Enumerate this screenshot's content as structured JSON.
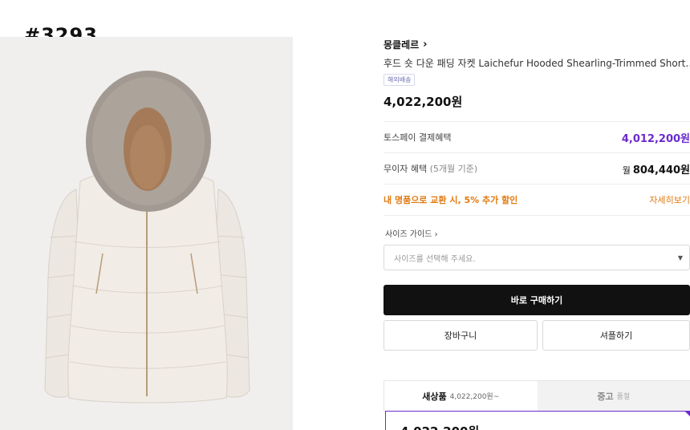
{
  "listing_id": "#3293",
  "product": {
    "brand": "몽클레르",
    "title": "후드 숏 다운 패딩 자켓 Laichefur Hooded Shearling-Trimmed Short Down Jacket",
    "shipping_badge": "해외배송",
    "price": "4,022,200원"
  },
  "benefits": [
    {
      "label": "토스페이 결제혜택",
      "value": "4,012,200원"
    },
    {
      "label": "무이자 혜택",
      "sub": "(5개월 기준)",
      "prefix": "월",
      "value": "804,440원"
    },
    {
      "label": "내 명품으로 교환 시, 5% 추가 할인",
      "value": "자세히보기"
    }
  ],
  "size": {
    "guide": "사이즈 가이드",
    "placeholder": "사이즈를 선택해 주세요."
  },
  "buttons": {
    "buy": "바로 구매하기",
    "cart": "장바구니",
    "share": "셔플하기"
  },
  "tabs": [
    {
      "label": "새상품",
      "sub": "4,022,200원~"
    },
    {
      "label": "중고",
      "sub": "품절"
    }
  ],
  "selected_card": {
    "price": "4,022,200원"
  },
  "colors": {
    "accent": "#6b2bd0",
    "orange": "#e07a12"
  }
}
